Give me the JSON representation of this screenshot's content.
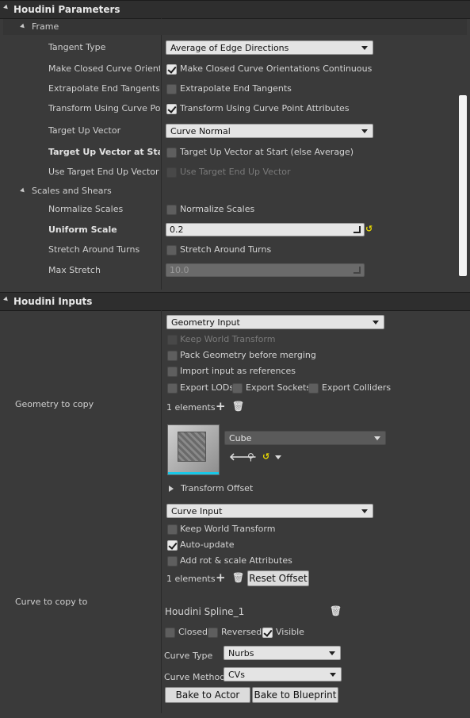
{
  "params": {
    "title": "Houdini Parameters",
    "frame": {
      "title": "Frame",
      "tangent_type": {
        "label": "Tangent Type",
        "value": "Average of Edge Directions"
      },
      "closed_curve": {
        "label": "Make Closed Curve Orientat",
        "check_label": "Make Closed Curve Orientations Continuous"
      },
      "extrapolate": {
        "label": "Extrapolate End Tangents",
        "check_label": "Extrapolate End Tangents"
      },
      "transform_curve": {
        "label": "Transform Using Curve Poin",
        "check_label": "Transform Using Curve Point Attributes"
      },
      "target_up": {
        "label": "Target Up Vector",
        "value": "Curve Normal"
      },
      "target_up_start": {
        "label": "Target Up Vector at Start (el",
        "check_label": "Target Up Vector at Start (else Average)"
      },
      "target_end_up": {
        "label": "Use Target End Up Vector",
        "check_label": "Use Target End Up Vector"
      }
    },
    "scales": {
      "title": "Scales and Shears",
      "normalize": {
        "label": "Normalize Scales",
        "check_label": "Normalize Scales"
      },
      "uniform_scale": {
        "label": "Uniform Scale",
        "value": "0.2"
      },
      "stretch_turns": {
        "label": "Stretch Around Turns",
        "check_label": "Stretch Around Turns"
      },
      "max_stretch": {
        "label": "Max Stretch",
        "value": "10.0"
      }
    }
  },
  "inputs": {
    "title": "Houdini Inputs",
    "geometry": {
      "label": "Geometry to copy",
      "input_type": "Geometry Input",
      "keep_world": "Keep World Transform",
      "pack_geo": "Pack Geometry before merging",
      "import_refs": "Import input as references",
      "export_lods": "Export LODs",
      "export_sockets": "Export Sockets",
      "export_colliders": "Export Colliders",
      "elements": "1 elements",
      "asset": "Cube",
      "transform_offset": "Transform Offset"
    },
    "curve": {
      "label": "Curve to copy to",
      "input_type": "Curve Input",
      "keep_world": "Keep World Transform",
      "auto_update": "Auto-update",
      "add_rot": "Add rot & scale Attributes",
      "elements": "1 elements",
      "reset_offset": "Reset Offset",
      "spline_name": "Houdini Spline_1",
      "closed": "Closed",
      "reversed": "Reversed",
      "visible": "Visible",
      "curve_type_label": "Curve Type",
      "curve_type": "Nurbs",
      "curve_method_label": "Curve Method",
      "curve_method": "CVs",
      "bake_actor": "Bake to Actor",
      "bake_blueprint": "Bake to Blueprint"
    }
  },
  "icons": {
    "add": "plus-icon",
    "delete": "trash-icon",
    "reset": "reset-arrow-icon",
    "browse": "search-icon",
    "use_selected": "left-arrow-icon"
  },
  "colors": {
    "accent": "#18c8e8",
    "reset_arrow": "#e8d800"
  }
}
